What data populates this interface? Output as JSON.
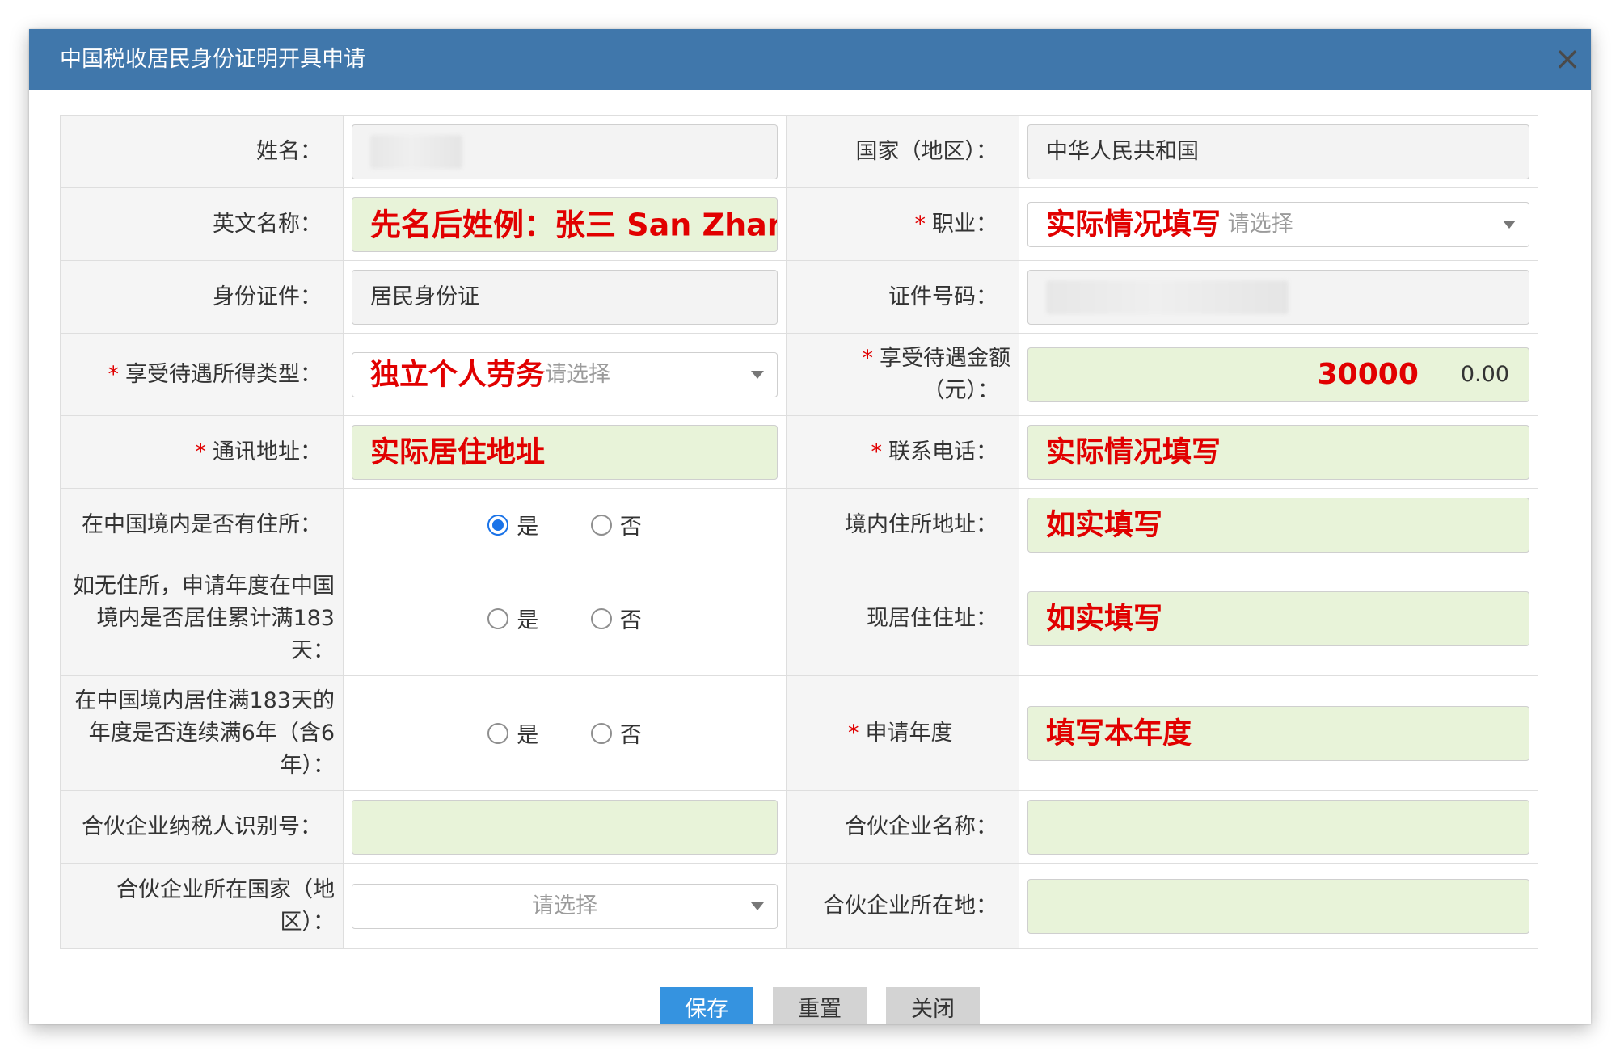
{
  "dialog": {
    "title": "中国税收居民身份证明开具申请",
    "close_label": "×"
  },
  "form": {
    "name": {
      "label": "姓名：",
      "value": ""
    },
    "country": {
      "label": "国家（地区）：",
      "value": "中华人民共和国"
    },
    "english_name": {
      "label": "英文名称：",
      "note": "先名后姓例：张三  San Zhang"
    },
    "occupation": {
      "required": "*",
      "label": "职业：",
      "note": "实际情况填写",
      "placeholder": "请选择"
    },
    "id_type": {
      "label": "身份证件：",
      "value": "居民身份证"
    },
    "id_number": {
      "label": "证件号码：",
      "value": ""
    },
    "income_type": {
      "required": "*",
      "label": "享受待遇所得类型：",
      "note": "独立个人劳务",
      "placeholder": "请选择"
    },
    "benefit_amount": {
      "required": "*",
      "label_line1": "享受待遇金额",
      "label_line2": "（元）：",
      "note": "30000",
      "value": "0.00"
    },
    "address": {
      "required": "*",
      "label": "通讯地址：",
      "note": "实际居住地址"
    },
    "phone": {
      "required": "*",
      "label": "联系电话：",
      "note": "实际情况填写"
    },
    "has_domicile": {
      "label": "在中国境内是否有住所：",
      "options": [
        "是",
        "否"
      ],
      "selected": "是"
    },
    "domicile_address": {
      "label": "境内住所地址：",
      "note": "如实填写"
    },
    "resided_183": {
      "label": "如无住所，申请年度在中国境内是否居住累计满183天：",
      "options": [
        "是",
        "否"
      ]
    },
    "current_address": {
      "label": "现居住住址：",
      "note": "如实填写"
    },
    "six_years": {
      "label": "在中国境内居住满183天的年度是否连续满6年（含6年）：",
      "options": [
        "是",
        "否"
      ]
    },
    "apply_year": {
      "required": "*",
      "label": "申请年度",
      "note": "填写本年度"
    },
    "partner_tax_id": {
      "label": "合伙企业纳税人识别号：",
      "value": ""
    },
    "partner_name": {
      "label": "合伙企业名称：",
      "value": ""
    },
    "partner_country": {
      "label": "合伙企业所在国家（地区）：",
      "placeholder": "请选择"
    },
    "partner_location": {
      "label": "合伙企业所在地：",
      "value": ""
    }
  },
  "buttons": {
    "save": "保存",
    "reset": "重置",
    "close": "关闭"
  },
  "colors": {
    "titlebar": "#4077ab",
    "primary_button": "#3593e0",
    "secondary_button": "#d3d3d3",
    "annotation_red": "#e10000",
    "editable_green": "#e8f3d9",
    "readonly_gray": "#f3f3f3"
  }
}
